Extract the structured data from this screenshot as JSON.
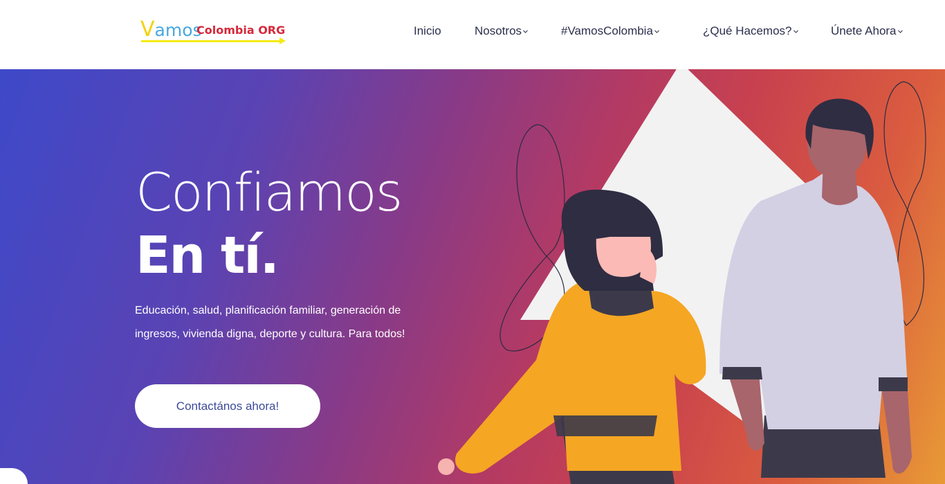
{
  "header": {
    "logo": {
      "first_letter": "V",
      "word": "amos",
      "rest": "Colombia ORG"
    },
    "nav": [
      {
        "label": "Inicio",
        "has_dropdown": false
      },
      {
        "label": "Nosotros",
        "has_dropdown": true
      },
      {
        "label": "#VamosColombia",
        "has_dropdown": true
      },
      {
        "label": "¿Qué Hacemos?",
        "has_dropdown": true
      },
      {
        "label": "Únete Ahora",
        "has_dropdown": true
      }
    ]
  },
  "hero": {
    "title_light": "Confiamos",
    "title_bold": "En tí.",
    "description_line1": "Educación, salud, planificación familiar, generación de",
    "description_line2": "ingresos, vivienda digna, deporte y cultura. Para todos!",
    "cta_label": "Contactános ahora!"
  },
  "colors": {
    "nav_text": "#2b2f4c",
    "cta_text": "#3c4a9a",
    "gradient_start": "#3e49c9",
    "gradient_mid": "#b43a63",
    "gradient_end": "#e89a36",
    "sweater": "#f5a623",
    "shirt": "#d2d0e4"
  }
}
